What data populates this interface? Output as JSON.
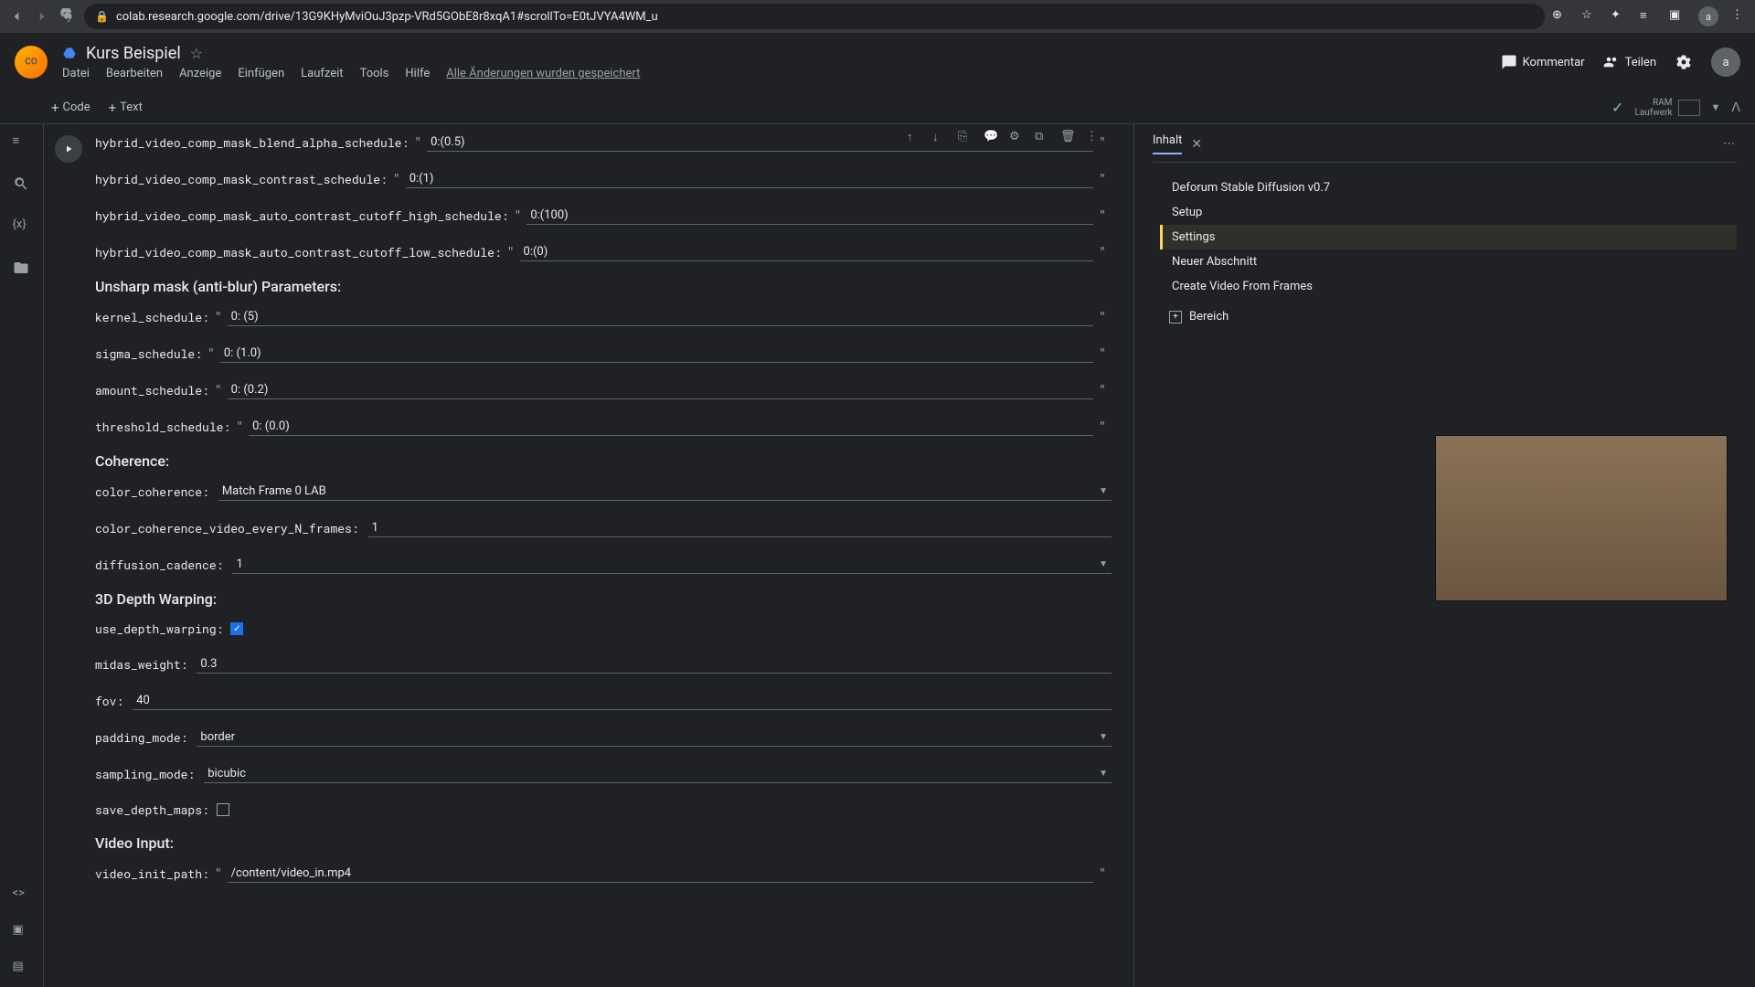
{
  "browser": {
    "url": "colab.research.google.com/drive/13G9KHyMviOuJ3pzp-VRd5GObE8r8xqA1#scrollTo=E0tJVYA4WM_u",
    "avatar": "a"
  },
  "header": {
    "doc_title": "Kurs Beispiel",
    "menu": [
      "Datei",
      "Bearbeiten",
      "Anzeige",
      "Einfügen",
      "Laufzeit",
      "Tools",
      "Hilfe"
    ],
    "saved": "Alle Änderungen wurden gespeichert",
    "comment": "Kommentar",
    "share": "Teilen",
    "avatar": "a"
  },
  "toolbar": {
    "code": "Code",
    "text": "Text",
    "ram": "RAM",
    "runtime": "Laufwerk"
  },
  "form": {
    "sections": {
      "unsharp": "Unsharp mask (anti-blur) Parameters:",
      "coherence": "Coherence:",
      "depth": "3D Depth Warping:",
      "video": "Video Input:"
    },
    "fields": [
      {
        "label": "hybrid_video_comp_mask_blend_alpha_schedule:",
        "value": "0:(0.5)",
        "type": "text",
        "quoted": true
      },
      {
        "label": "hybrid_video_comp_mask_contrast_schedule:",
        "value": "0:(1)",
        "type": "text",
        "quoted": true
      },
      {
        "label": "hybrid_video_comp_mask_auto_contrast_cutoff_high_schedule:",
        "value": "0:(100)",
        "type": "text",
        "quoted": true
      },
      {
        "label": "hybrid_video_comp_mask_auto_contrast_cutoff_low_schedule:",
        "value": "0:(0)",
        "type": "text",
        "quoted": true
      }
    ],
    "unsharp_fields": [
      {
        "label": "kernel_schedule:",
        "value": "0: (5)",
        "type": "text",
        "quoted": true
      },
      {
        "label": "sigma_schedule:",
        "value": "0: (1.0)",
        "type": "text",
        "quoted": true
      },
      {
        "label": "amount_schedule:",
        "value": "0: (0.2)",
        "type": "text",
        "quoted": true
      },
      {
        "label": "threshold_schedule:",
        "value": "0: (0.0)",
        "type": "text",
        "quoted": true
      }
    ],
    "coherence_fields": [
      {
        "label": "color_coherence:",
        "value": "Match Frame 0 LAB",
        "type": "select"
      },
      {
        "label": "color_coherence_video_every_N_frames:",
        "value": "1",
        "type": "text"
      },
      {
        "label": "diffusion_cadence:",
        "value": "1",
        "type": "select"
      }
    ],
    "depth_fields": [
      {
        "label": "use_depth_warping:",
        "value": true,
        "type": "checkbox"
      },
      {
        "label": "midas_weight:",
        "value": "0.3",
        "type": "text"
      },
      {
        "label": "fov:",
        "value": "40",
        "type": "text"
      },
      {
        "label": "padding_mode:",
        "value": "border",
        "type": "select"
      },
      {
        "label": "sampling_mode:",
        "value": "bicubic",
        "type": "select"
      },
      {
        "label": "save_depth_maps:",
        "value": false,
        "type": "checkbox"
      }
    ],
    "video_fields": [
      {
        "label": "video_init_path:",
        "value": "/content/video_in.mp4",
        "type": "text",
        "quoted": true
      }
    ]
  },
  "toc": {
    "title": "Inhalt",
    "items": [
      "Deforum Stable Diffusion v0.7",
      "Setup",
      "Settings",
      "Neuer Abschnitt",
      "Create Video From Frames"
    ],
    "active_index": 2,
    "section_btn": "Bereich"
  }
}
